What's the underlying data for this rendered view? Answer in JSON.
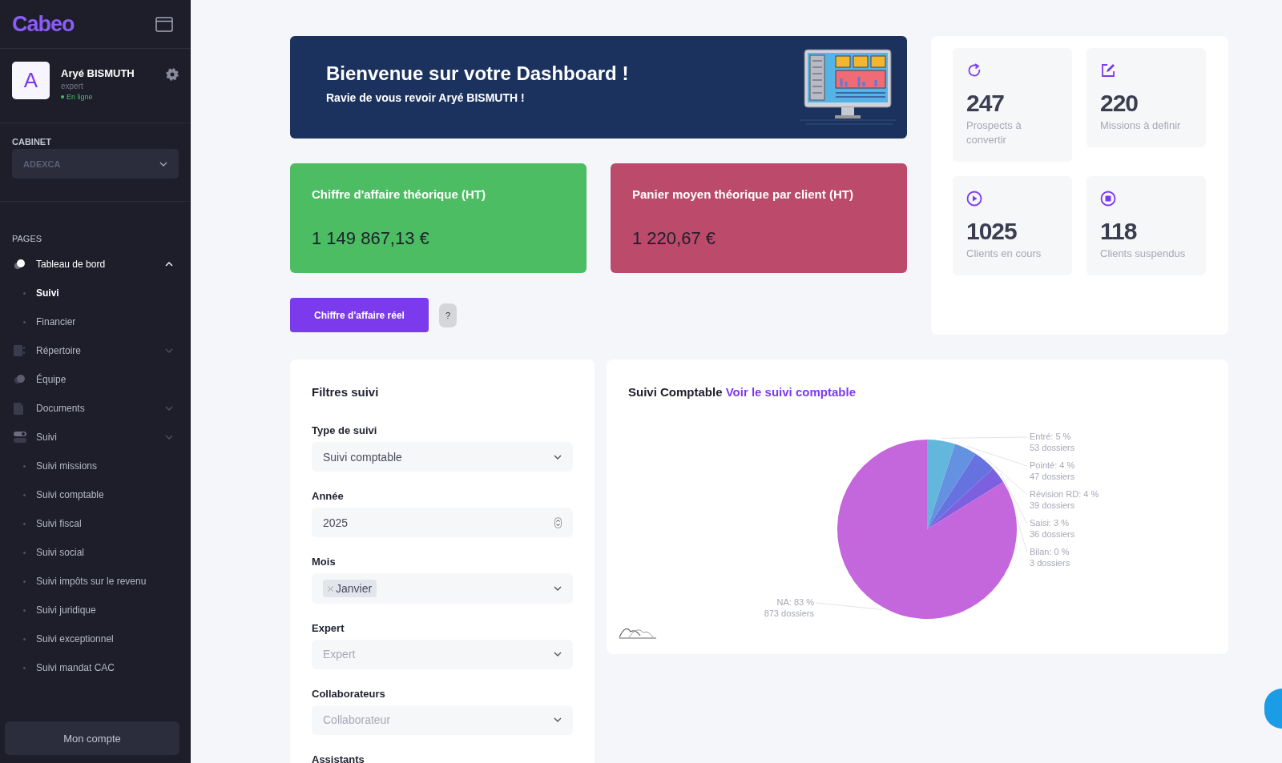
{
  "sidebar": {
    "logo": "Cabeo",
    "user": {
      "initial": "A",
      "name": "Aryé BISMUTH",
      "role": "expert",
      "status": "En ligne",
      "online": true
    },
    "cabinet": {
      "label": "CABINET",
      "value": "ADEXCA"
    },
    "section": "PAGES",
    "nav": [
      {
        "label": "Tableau de bord",
        "selected": true,
        "expanded": true,
        "children": [
          {
            "label": "Suivi",
            "selected": true
          },
          {
            "label": "Financier",
            "selected": false
          }
        ]
      },
      {
        "label": "Répertoire",
        "selected": false,
        "expanded": false
      },
      {
        "label": "Équipe",
        "selected": false
      },
      {
        "label": "Documents",
        "selected": false,
        "expanded": false
      },
      {
        "label": "Suivi",
        "selected": false,
        "expanded": false,
        "children": [
          {
            "label": "Suivi missions",
            "selected": false
          },
          {
            "label": "Suivi comptable",
            "selected": false
          },
          {
            "label": "Suivi fiscal",
            "selected": false
          },
          {
            "label": "Suivi social",
            "selected": false
          },
          {
            "label": "Suivi impôts sur le revenu",
            "selected": false
          },
          {
            "label": "Suivi juridique",
            "selected": false
          },
          {
            "label": "Suivi exceptionnel",
            "selected": false
          },
          {
            "label": "Suivi mandat CAC",
            "selected": false
          }
        ]
      }
    ],
    "account_button": "Mon compte"
  },
  "banner": {
    "title": "Bienvenue sur votre Dashboard !",
    "subtitle": "Ravie de vous revoir Aryé BISMUTH !"
  },
  "kpis": [
    {
      "label": "Chiffre d'affaire théorique (HT)",
      "value": "1 149 867,13 €",
      "color": "#4cbd63"
    },
    {
      "label": "Panier moyen théorique par client (HT)",
      "value": "1 220,67 €",
      "color": "#bb4a6b"
    }
  ],
  "real_revenue_button": "Chiffre d'affaire réel",
  "help_button": "?",
  "stats": [
    {
      "value": "247",
      "label": "Prospects à convertir"
    },
    {
      "value": "220",
      "label": "Missions à definir"
    },
    {
      "value": "1025",
      "label": "Clients en cours"
    },
    {
      "value": "118",
      "label": "Clients suspendus"
    }
  ],
  "filters": {
    "title": "Filtres suivi",
    "fields": [
      {
        "label": "Type de suivi",
        "kind": "select",
        "value": "Suivi comptable"
      },
      {
        "label": "Année",
        "kind": "number",
        "value": "2025"
      },
      {
        "label": "Mois",
        "kind": "tags",
        "tags": [
          "Janvier"
        ]
      },
      {
        "label": "Expert",
        "kind": "select",
        "placeholder": "Expert"
      },
      {
        "label": "Collaborateurs",
        "kind": "select",
        "placeholder": "Collaborateur"
      },
      {
        "label": "Assistants"
      }
    ]
  },
  "accounting": {
    "title": "Suivi Comptable",
    "link": "Voir le suivi comptable",
    "chart_data": {
      "type": "pie",
      "values": [
        5,
        4,
        4,
        3,
        0,
        83
      ],
      "colors": [
        "#63b7dd",
        "#6592e0",
        "#6672e0",
        "#7d60df",
        "#9060e0",
        "#c466dc"
      ],
      "value_labels": [
        [
          "Entré: 5 %",
          "53 dossiers"
        ],
        [
          "Pointé: 4 %",
          "47 dossiers"
        ],
        [
          "Révision RD: 4 %",
          "39 dossiers"
        ],
        [
          "Saisi: 3 %",
          "36 dossiers"
        ],
        [
          "Bilan: 0 %",
          "3 dossiers"
        ],
        [
          "NA: 83 %",
          "873 dossiers"
        ]
      ]
    }
  }
}
